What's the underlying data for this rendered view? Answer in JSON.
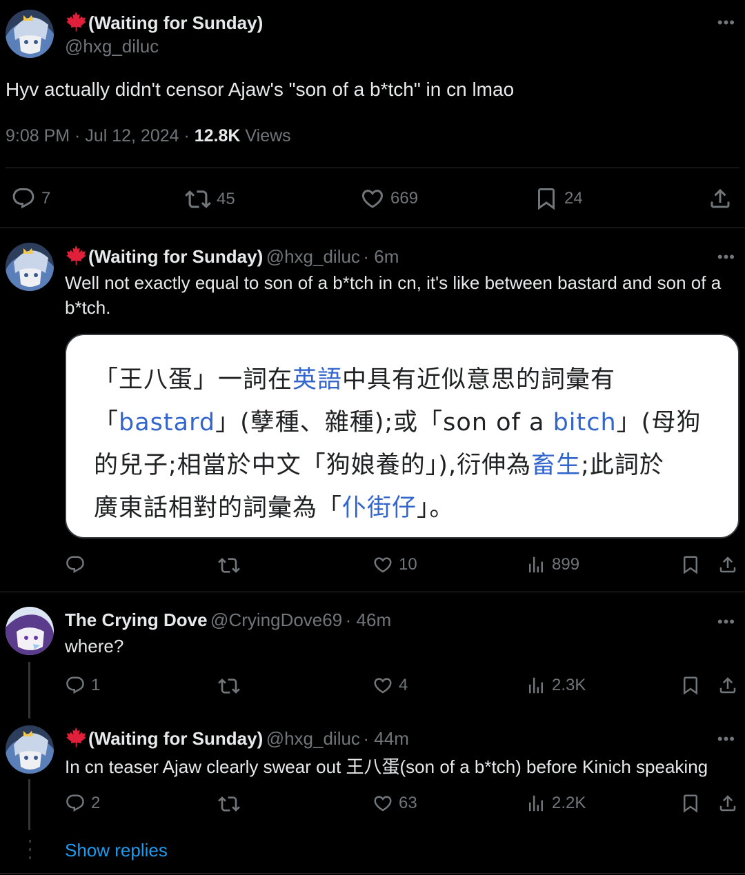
{
  "main_tweet": {
    "display_name": "(Waiting for Sunday)",
    "handle": "@hxg_diluc",
    "text": "Hyv actually didn't censor Ajaw's \"son of a b*tch\" in cn lmao",
    "time": "9:08 PM · Jul 12, 2024 · ",
    "views_count": "12.8K",
    "views_label": " Views",
    "replies": "7",
    "reposts": "45",
    "likes": "669",
    "bookmarks": "24"
  },
  "reply1": {
    "display_name": "(Waiting for Sunday)",
    "handle": "@hxg_diluc",
    "age": "· 6m",
    "text": "Well not exactly equal to son of a b*tch in cn, it's like between bastard and son of a b*tch.",
    "likes": "10",
    "views": "899",
    "image_text": {
      "l1a": "「王八蛋」一詞在",
      "l1link": "英語",
      "l1b": "中具有近似意思的詞彙有",
      "l2a": "「",
      "l2link": "bastard",
      "l2b": "」(孽種、雜種);或「son of a ",
      "l2link2": "bitch",
      "l2c": "」(母狗",
      "l3a": "的兒子;相當於中文「狗娘養的」),衍伸為",
      "l3link": "畜生",
      "l3b": ";此詞於",
      "l4a": "廣東話相對的詞彙為「",
      "l4link": "仆街仔",
      "l4b": "」。"
    }
  },
  "reply2": {
    "display_name": "The Crying Dove",
    "handle": "@CryingDove69",
    "age": "· 46m",
    "text": "where?",
    "replies": "1",
    "likes": "4",
    "views": "2.3K"
  },
  "reply3": {
    "display_name": "(Waiting for Sunday)",
    "handle": "@hxg_diluc",
    "age": "· 44m",
    "text": "In cn teaser Ajaw clearly swear out 王八蛋(son of a b*tch) before Kinich speaking",
    "replies": "2",
    "likes": "63",
    "views": "2.2K"
  },
  "show_replies": "Show replies",
  "colors": {
    "background": "#000000",
    "text": "#e7e9ea",
    "muted": "#71767b",
    "link": "#1d9bf0",
    "maple": "#e0203a"
  }
}
